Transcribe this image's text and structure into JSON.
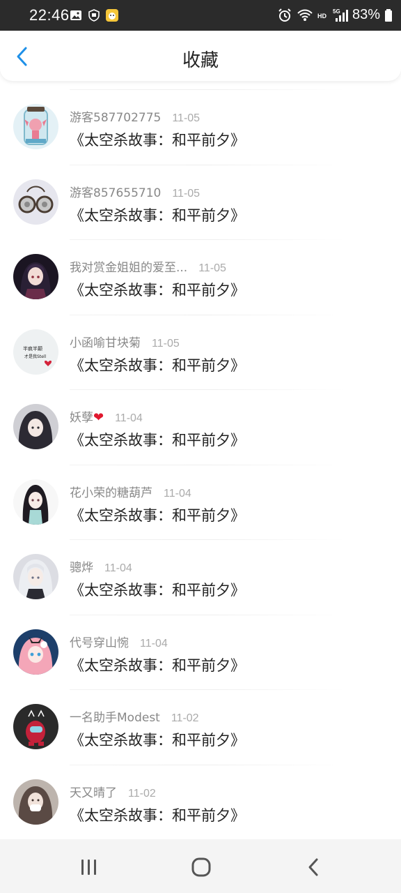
{
  "status_bar": {
    "time": "22:46",
    "battery": "83%",
    "left_icons": [
      "gallery-icon",
      "shield-icon",
      "app-icon"
    ],
    "right_icons": [
      "alarm-icon",
      "wifi-icon",
      "hd-icon",
      "5g-signal-icon",
      "battery-icon"
    ]
  },
  "header": {
    "title": "收藏",
    "back_icon": "chevron-left-icon",
    "accent_color": "#1e90e8"
  },
  "favorites": [
    {
      "user": "游客587702775",
      "date": "11-05",
      "title": "《太空杀故事：和平前夕》",
      "heart": false
    },
    {
      "user": "游客857655710",
      "date": "11-05",
      "title": "《太空杀故事：和平前夕》",
      "heart": false
    },
    {
      "user": "我对赏金姐姐的爱至...",
      "date": "11-05",
      "title": "《太空杀故事：和平前夕》",
      "heart": false
    },
    {
      "user": "小函喻甘块菊",
      "date": "11-05",
      "title": "《太空杀故事：和平前夕》",
      "heart": false
    },
    {
      "user": "妖孽",
      "date": "11-04",
      "title": "《太空杀故事：和平前夕》",
      "heart": true
    },
    {
      "user": "花小荣的糖葫芦",
      "date": "11-04",
      "title": "《太空杀故事：和平前夕》",
      "heart": false
    },
    {
      "user": "骢烨",
      "date": "11-04",
      "title": "《太空杀故事：和平前夕》",
      "heart": false
    },
    {
      "user": "代号穿山惋",
      "date": "11-04",
      "title": "《太空杀故事：和平前夕》",
      "heart": false
    },
    {
      "user": "一名助手Modest",
      "date": "11-02",
      "title": "《太空杀故事：和平前夕》",
      "heart": false
    },
    {
      "user": "天又晴了",
      "date": "11-02",
      "title": "《太空杀故事：和平前夕》",
      "heart": false
    }
  ],
  "avatar3_text": [
    "半疯半颠",
    "才是我Stell"
  ],
  "nav_bar": {
    "buttons": [
      "recent-apps-icon",
      "home-icon",
      "back-icon"
    ]
  }
}
